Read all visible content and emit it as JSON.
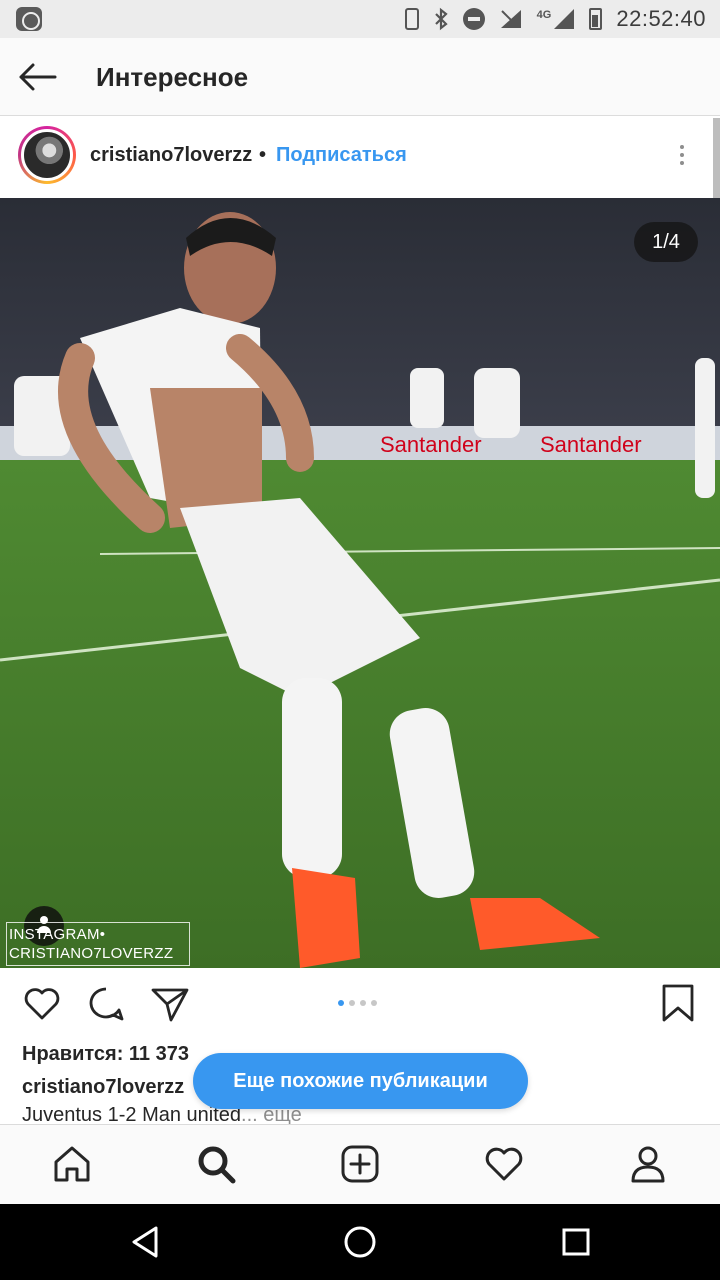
{
  "status_bar": {
    "time": "22:52:40",
    "network": "4G",
    "icons": [
      "app-notification-icon",
      "phone-icon",
      "bluetooth-icon",
      "do-not-disturb-icon",
      "wifi-off-icon",
      "signal-icon",
      "battery-icon"
    ]
  },
  "header": {
    "title": "Интересное",
    "back_icon": "arrow-left-icon"
  },
  "post": {
    "username": "cristiano7loverzz",
    "separator": "•",
    "follow_label": "Подписаться",
    "counter": "1/4",
    "watermark_line1": "INSTAGRAM•",
    "watermark_line2": "CRISTIANO7LOVERZZ",
    "likes_text": "Нравится: 11 373",
    "caption_user": "cristiano7loverzz",
    "caption_text": "Juventus 1-2 Man united",
    "caption_more": "... еще",
    "similar_button": "Еще похожие публикации",
    "carousel": {
      "total": 4,
      "current": 1
    }
  },
  "colors": {
    "accent": "#3897f0",
    "text": "#262626",
    "muted": "#8e8e8e"
  },
  "tab_bar": {
    "items": [
      "home-icon",
      "search-icon",
      "add-post-icon",
      "activity-heart-icon",
      "profile-icon"
    ],
    "active": "search-icon"
  },
  "android_nav": {
    "items": [
      "back-triangle-icon",
      "home-circle-icon",
      "recents-square-icon"
    ]
  }
}
